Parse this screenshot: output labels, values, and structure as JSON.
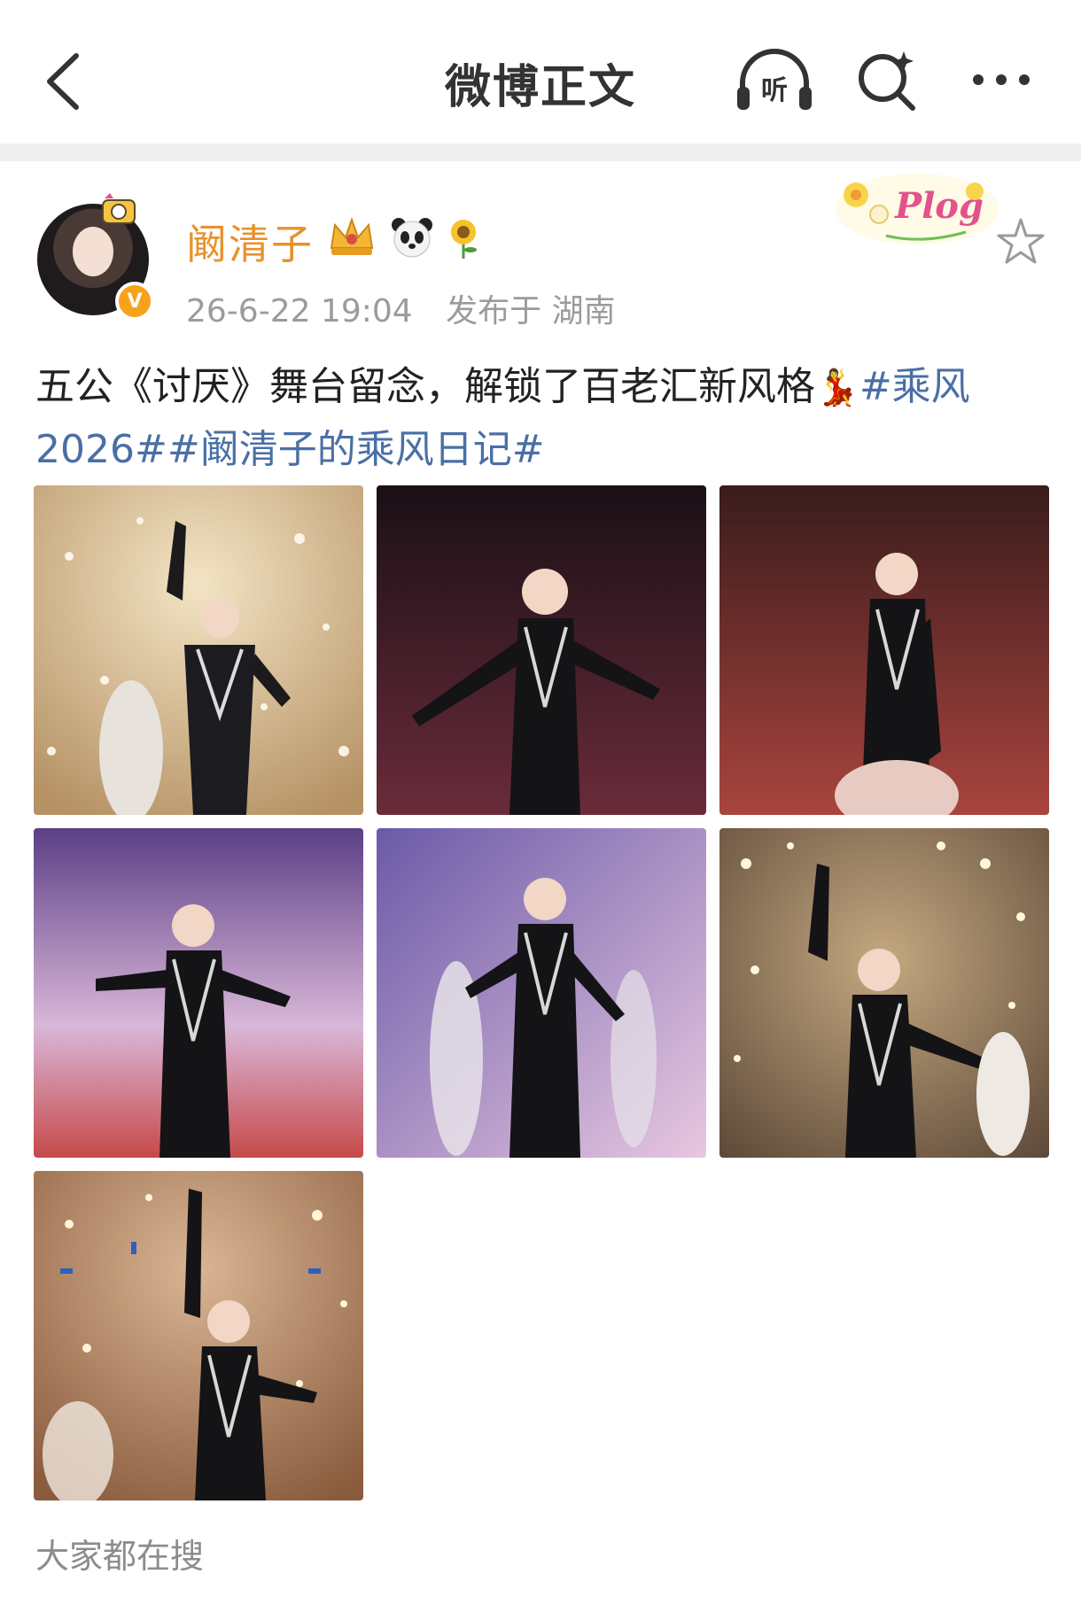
{
  "header": {
    "title": "微博正文",
    "listen_label": "听",
    "icons": [
      "back-icon",
      "headphones-icon",
      "search-icon",
      "more-icon"
    ]
  },
  "post": {
    "author": "阚清子",
    "verified_mark": "V",
    "time": "26-6-22 19:04",
    "location": "发布于 湖南",
    "plog_sticker": "Plog",
    "text_plain": "五公《讨厌》舞台留念，解锁了百老汇新风格",
    "emoji": "💃",
    "hashtags": [
      "#乘风2026#",
      "#阚清子的乘风日记#"
    ],
    "images": [
      {
        "name": "photo-1",
        "theme": "gold"
      },
      {
        "name": "photo-2",
        "theme": "dark"
      },
      {
        "name": "photo-3",
        "theme": "red"
      },
      {
        "name": "photo-4",
        "theme": "purple"
      },
      {
        "name": "photo-5",
        "theme": "violet"
      },
      {
        "name": "photo-6",
        "theme": "sparkle"
      },
      {
        "name": "photo-7",
        "theme": "orange"
      }
    ]
  },
  "footer": {
    "trending_label": "大家都在搜"
  },
  "colors": {
    "author": "#e8912b",
    "hashtag": "#4a6fa5",
    "meta": "#9b9b9b"
  }
}
